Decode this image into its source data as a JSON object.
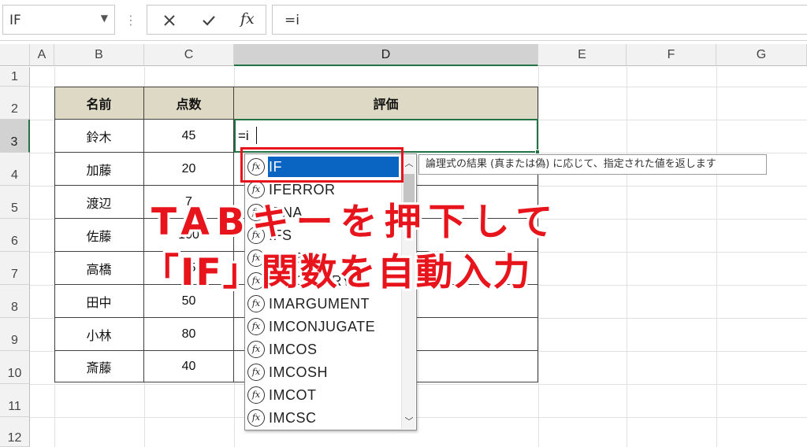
{
  "formula_bar": {
    "name_box": "IF",
    "fx_label": "fx",
    "formula": "=i"
  },
  "columns": [
    "A",
    "B",
    "C",
    "D",
    "E",
    "F",
    "G"
  ],
  "rows": [
    "1",
    "2",
    "3",
    "4",
    "5",
    "6",
    "7",
    "8",
    "9",
    "10",
    "11",
    "12"
  ],
  "table": {
    "headers": [
      "名前",
      "点数",
      "評価"
    ],
    "rows": [
      {
        "name": "鈴木",
        "score": "45"
      },
      {
        "name": "加藤",
        "score": "20"
      },
      {
        "name": "渡辺",
        "score": "7"
      },
      {
        "name": "佐藤",
        "score": "100"
      },
      {
        "name": "高橋",
        "score": "15"
      },
      {
        "name": "田中",
        "score": "50"
      },
      {
        "name": "小林",
        "score": "80"
      },
      {
        "name": "斎藤",
        "score": "40"
      }
    ]
  },
  "active_cell": {
    "ref": "D3",
    "value": "=i"
  },
  "autocomplete": {
    "items": [
      "IF",
      "IFERROR",
      "IFNA",
      "IFS",
      "IMABS",
      "IMAGINARY",
      "IMARGUMENT",
      "IMCONJUGATE",
      "IMCOS",
      "IMCOSH",
      "IMCOT",
      "IMCSC"
    ],
    "selected": "IF",
    "icon": "fx",
    "tooltip": "論理式の結果 (真または偽) に応じて、指定された値を返します"
  },
  "overlay": {
    "line1": "TABキーを押下して",
    "line2": "「IF」関数を自動入力"
  },
  "colors": {
    "header_fill": "#ddd9c4",
    "highlight_red": "#e8141c",
    "selection_blue": "#0a64c2",
    "excel_green": "#217346"
  }
}
